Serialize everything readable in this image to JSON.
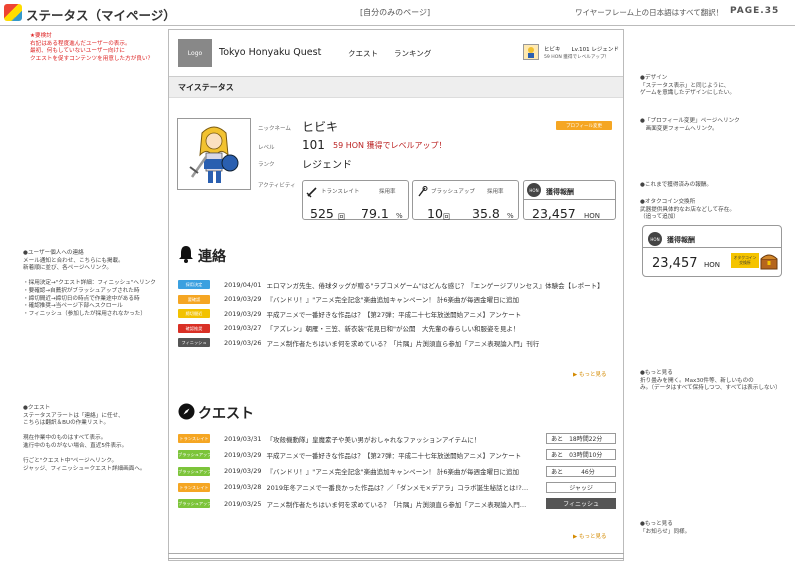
{
  "header": {
    "title": "ステータス（マイページ）",
    "center": "[自分のみのページ]",
    "right": "ワイヤーフレーム上の日本語はすべて翻訳！",
    "page": "PAGE.35"
  },
  "notes": {
    "top_left": "★要検討\n右記はある程度進んだユーザーの表示。\n最初、何もしていないユーザー向けに\nクエストを促すコンテンツを用意した方が良い？",
    "left_contact": "●ユーザー個人への連絡\nメール通知と合わせ、こちらにも掲載。\n新着順に並び、各ページへリンク。\n\n・採用決定→\"クエスト詳細：フィニッシュ\"へリンク\n・要確認→自薦択がブラッシュアップされた時\n・締切間近→締切日の時点で作業途中がある時\n・確認推奨→当ページ下部へスクロール\n・フィニッシュ（参加したが採用されなかった）",
    "left_quest": "●クエスト\nステータスアラートは「連絡」に任せ、\nこちらは翻訳＆BUの作業リスト。\n\n現在作業中のものはすべて表示。\n進行中のものがない場合、直近5件表示。\n\n行ごと\"クエスト中\"ページへリンク。\nジャッジ、フィニッシュ＝クエスト詳細画面へ。",
    "right_design": "●デザイン\n「ステータス表示」と同じように、\nゲームを意識したデザインにしたい。",
    "right_profile": "●「プロフィール変更」ページへリンク\n　画面変更フォームへリンク。",
    "right_reward": "●これまで獲得済みの報酬。",
    "right_coin": "●オタクコイン交換所\n武器提供具体的なお店などして存在。\n（追って追加）",
    "right_more1": "●もっと見る\n折り畳みを開く。Max30件等、新しいものの\nみ。（データはすべて保持しつつ、すべては表示しない）",
    "right_more2": "●もっと見る\n「お知らせ」同様。"
  },
  "site": {
    "logo": "Logo",
    "name": "Tokyo Honyaku Quest",
    "nav_quest": "クエスト",
    "nav_ranking": "ランキング",
    "user_line": "ヒビキ　　Lv.101 レジェンド",
    "user_sub": "59 HON 獲得でレベルアップ！"
  },
  "page": {
    "band_title": "マイステータス"
  },
  "profile": {
    "lbl_name": "ニックネーム",
    "name": "ヒビキ",
    "lbl_level": "レベル",
    "level": "101",
    "level_msg": "59 HON 獲得でレベルアップ！",
    "lbl_rank": "ランク",
    "rank": "レジェンド",
    "lbl_activity": "アクティビティ",
    "edit_button": "プロフィール変更"
  },
  "stats": {
    "translate": {
      "label": "トランスレイト",
      "rate_label": "採用率",
      "count": "525",
      "unit": "回",
      "rate": "79.1",
      "pct": "%"
    },
    "brushup": {
      "label": "ブラッシュアップ",
      "rate_label": "採用率",
      "count": "10",
      "unit": "回",
      "rate": "35.8",
      "pct": "%"
    },
    "reward": {
      "label": "獲得報酬",
      "icon": "HON",
      "value": "23,457",
      "unit": "HON"
    }
  },
  "contact": {
    "title": "連絡",
    "items": [
      {
        "badge": "採用決定",
        "color": "#3aa0e0",
        "date": "2019/04/01",
        "text": "エロマンガ先生、倦球タッグが贈る\"ラブコメゲーム\"はどんな感じ？『エンゲージプリンセス』体験会【レポート】"
      },
      {
        "badge": "要確認",
        "color": "#f5a623",
        "date": "2019/03/29",
        "text": "『バンドリ！』\"アニメ完全記念\"楽曲追加キャンペーン！ 計6楽曲が毎週金曜日に追加"
      },
      {
        "badge": "締切間近",
        "color": "#f2c200",
        "date": "2019/03/29",
        "text": "平成アニメで一番好きな作品は？【第27弾：平成二十七年放送開始アニメ】アンケート"
      },
      {
        "badge": "確認推奨",
        "color": "#d93025",
        "date": "2019/03/27",
        "text": "「アズレン」朝雁・三笠、新衣装\"花見日和\"が公開　大先輩の春らしい和服姿を見よ！"
      },
      {
        "badge": "フィニッシュ",
        "color": "#555555",
        "date": "2019/03/26",
        "text": "アニメ制作者たちはいま何を求めている？「片隅」片渕須直ら参加「アニメ表現論入門」刊行"
      }
    ],
    "more": "▶ もっと見る"
  },
  "quest": {
    "title": "クエスト",
    "items": [
      {
        "badge": "トランスレイト",
        "color": "#f5a623",
        "date": "2019/03/31",
        "text": "「攻殻機動隊」皇魔素子や美い男がおしゃれなファッションアイテムに！",
        "status": "あと　18時間22分",
        "dark": false
      },
      {
        "badge": "ブラッシュアップ",
        "color": "#7cc43a",
        "date": "2019/03/29",
        "text": "平成アニメで一番好きな作品は？【第27弾：平成二十七年放送開始アニメ】アンケート",
        "status": "あと　03時間10分",
        "dark": false
      },
      {
        "badge": "ブラッシュアップ",
        "color": "#7cc43a",
        "date": "2019/03/29",
        "text": "『バンドリ！』\"アニメ完全記念\"楽曲追加キャンペーン！ 計6楽曲が毎週金曜日に追加",
        "status": "あと　　　46分",
        "dark": false
      },
      {
        "badge": "トランスレイト",
        "color": "#f5a623",
        "date": "2019/03/28",
        "text": "2019年冬アニメで一番良かった作品は？／「ダンメモ×デアラ」コラボ誕生秘話とは!?…",
        "status": "ジャッジ",
        "dark": false
      },
      {
        "badge": "ブラッシュアップ",
        "color": "#7cc43a",
        "date": "2019/03/25",
        "text": "アニメ制作者たちはいま何を求めている？「片隅」片渕須直ら参加「アニメ表現論入門…",
        "status": "フィニッシュ",
        "dark": true
      }
    ],
    "more": "▶ もっと見る"
  },
  "side_reward": {
    "icon": "HON",
    "label": "獲得報酬",
    "value": "23,457",
    "unit": "HON",
    "shop": "オタクコイン\n交換所"
  }
}
